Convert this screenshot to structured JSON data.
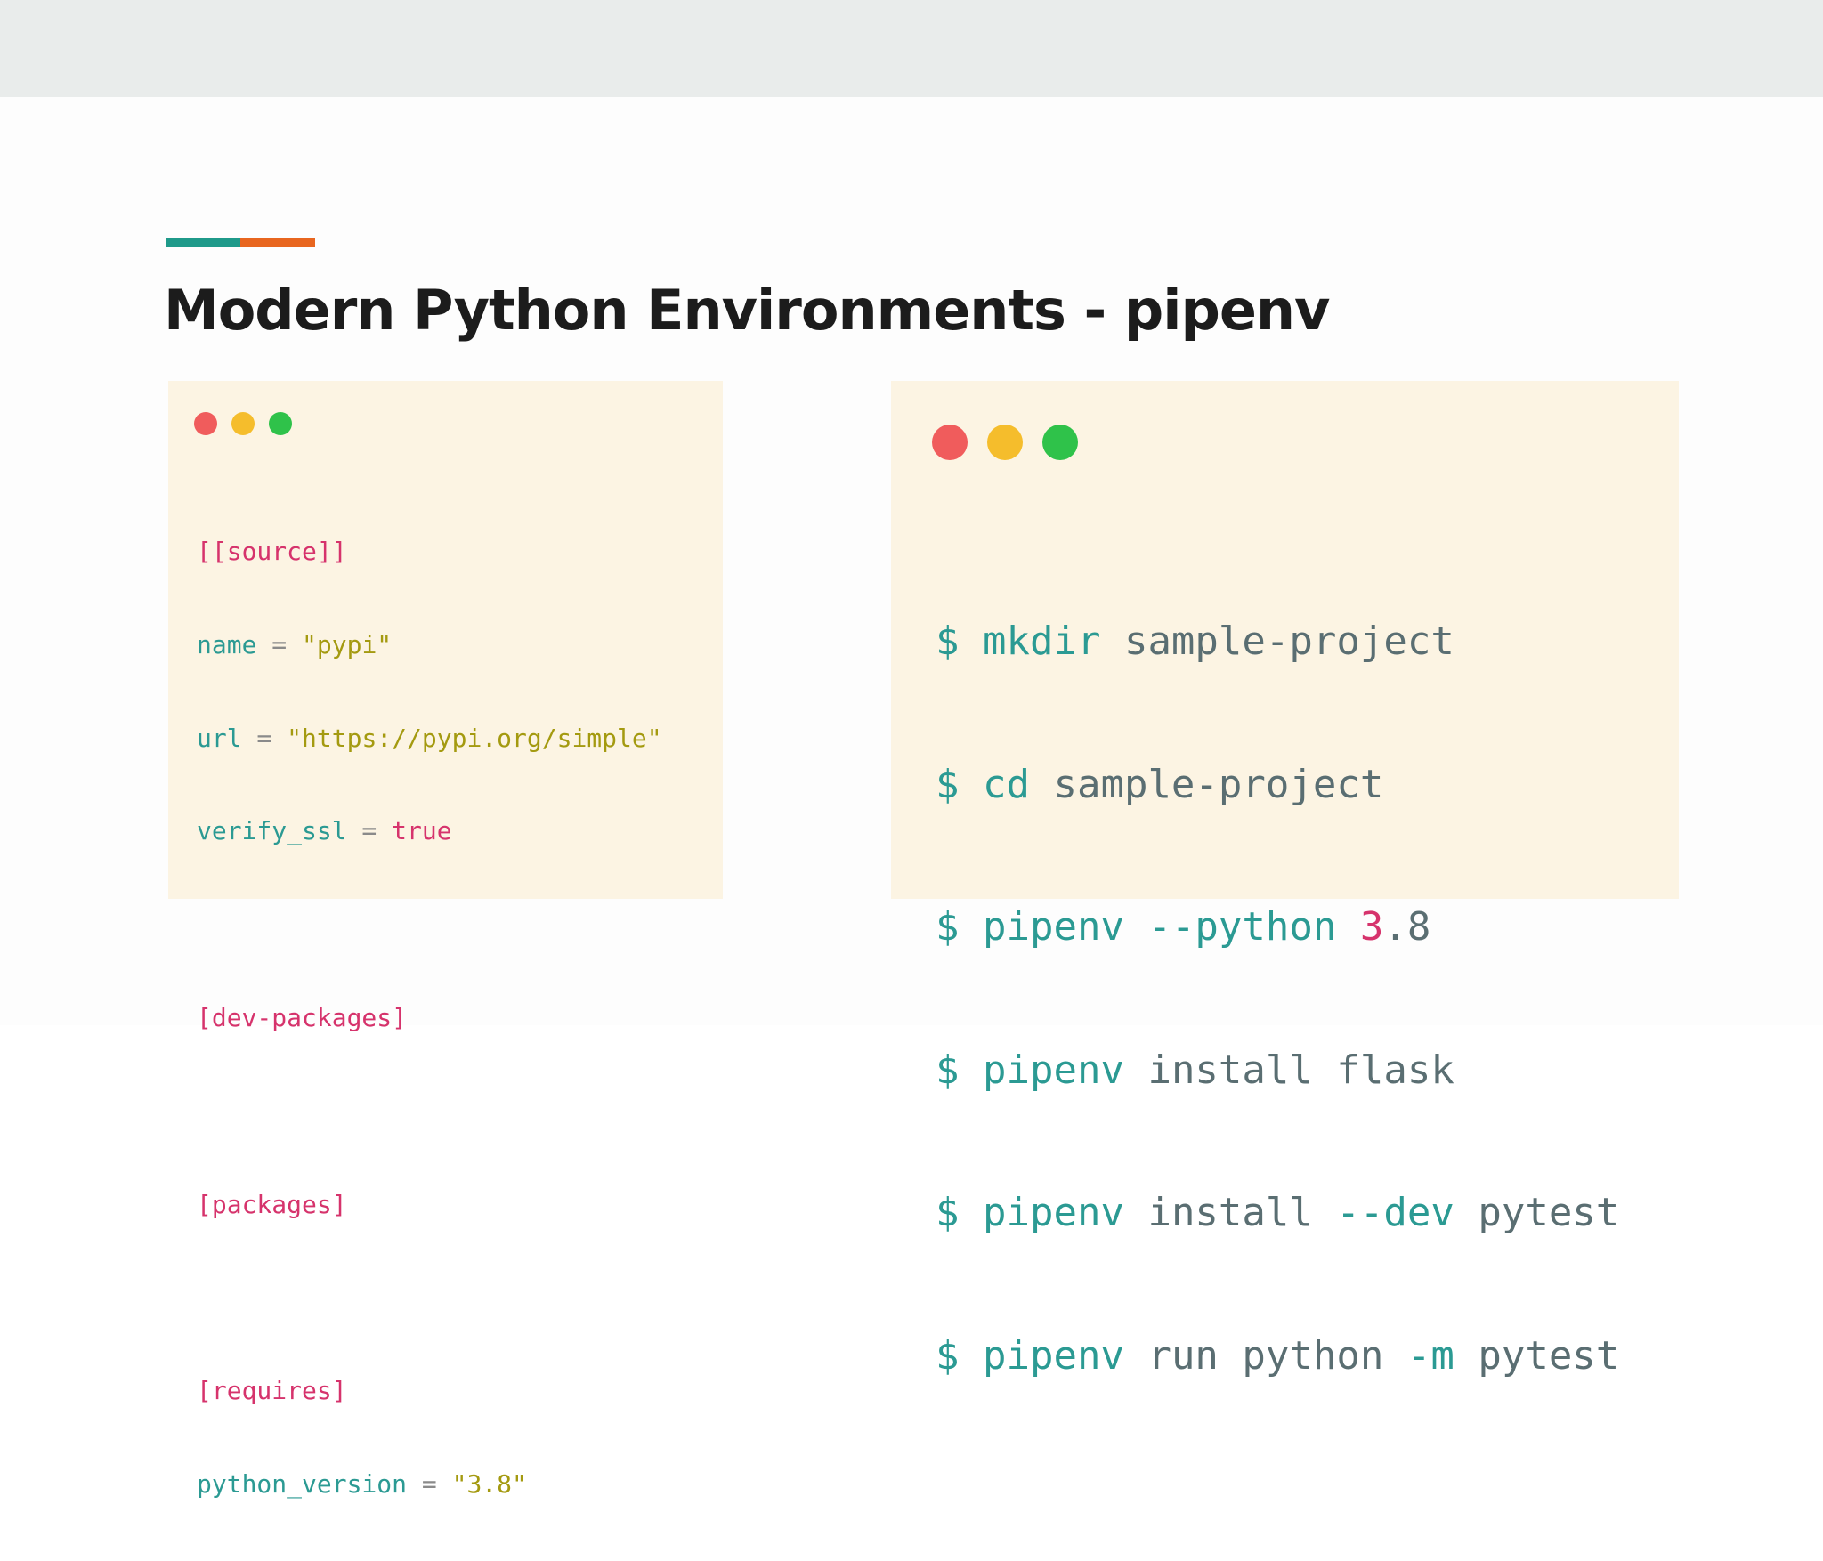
{
  "slide": {
    "title": "Modern Python Environments - pipenv",
    "accent_colors": [
      "#1f9a8a",
      "#e8661f"
    ],
    "background": "#fdfdfd",
    "band_color": "#e9eceb"
  },
  "pipfile_window": {
    "traffic_lights": [
      "red-dot",
      "yellow-dot",
      "green-dot"
    ],
    "background": "#fcf4e3",
    "lines": {
      "source_header": "[[source]]",
      "name_key": "name",
      "name_eq": " = ",
      "name_value": "\"pypi\"",
      "url_key": "url",
      "url_eq": " = ",
      "url_value": "\"https://pypi.org/simple\"",
      "verify_key": "verify_ssl",
      "verify_eq": " = ",
      "verify_value": "true",
      "dev_packages_header": "[dev-packages]",
      "packages_header": "[packages]",
      "requires_header": "[requires]",
      "python_version_key": "python_version",
      "python_version_eq": " = ",
      "python_version_value": "\"3.8\""
    }
  },
  "terminal_window": {
    "traffic_lights": [
      "red-dot",
      "yellow-dot",
      "green-dot"
    ],
    "background": "#fcf4e3",
    "commands": [
      {
        "prompt": "$",
        "cmd": "mkdir",
        "rest": "sample-project"
      },
      {
        "prompt": "$",
        "cmd": "cd",
        "rest": "sample-project"
      },
      {
        "prompt": "$",
        "cmd": "pipenv",
        "flag": "--python",
        "num_major": "3",
        "num_minor": ".8"
      },
      {
        "prompt": "$",
        "cmd": "pipenv",
        "rest": "install flask"
      },
      {
        "prompt": "$",
        "cmd": "pipenv",
        "rest": "install",
        "flag": "--dev",
        "rest2": "pytest"
      },
      {
        "prompt": "$",
        "cmd": "pipenv",
        "rest": "run python",
        "flag": "-m",
        "rest2": "pytest"
      }
    ]
  }
}
